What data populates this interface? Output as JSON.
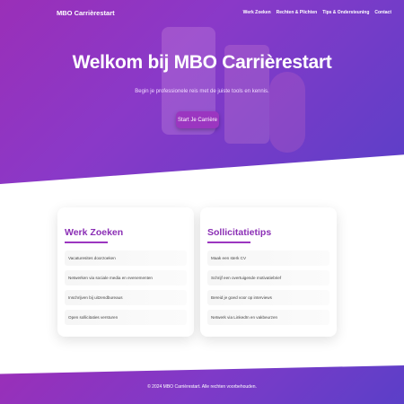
{
  "colors": {
    "primary": "#9b36c0",
    "gradient_start": "#9a2fb8",
    "gradient_end": "#5b3fc8",
    "card_title": "#8b2fb5"
  },
  "nav": {
    "brand": "MBO Carrièrestart",
    "links": [
      "Werk Zoeken",
      "Rechten & Plichten",
      "Tips & Ondersteuning",
      "Contact"
    ]
  },
  "hero": {
    "title": "Welkom bij MBO Carrièrestart",
    "subtitle": "Begin je professionele reis met de juiste tools en kennis.",
    "cta_label": "Start Je Carrière"
  },
  "cards": [
    {
      "title": "Werk Zoeken",
      "items": [
        "Vacaturesites doorzoeken",
        "Netwerken via sociale media en evenementen",
        "Inschrijven bij uitzendbureaus",
        "Open sollicitaties versturen"
      ]
    },
    {
      "title": "Sollicitatietips",
      "items": [
        "Maak een sterk CV",
        "Schrijf een overtuigende motivatiebrief",
        "Bereid je goed voor op interviews",
        "Netwerk via LinkedIn en vakbeurzen"
      ]
    }
  ],
  "footer": {
    "text": "© 2024 MBO Carrièrestart. Alle rechten voorbehouden."
  }
}
